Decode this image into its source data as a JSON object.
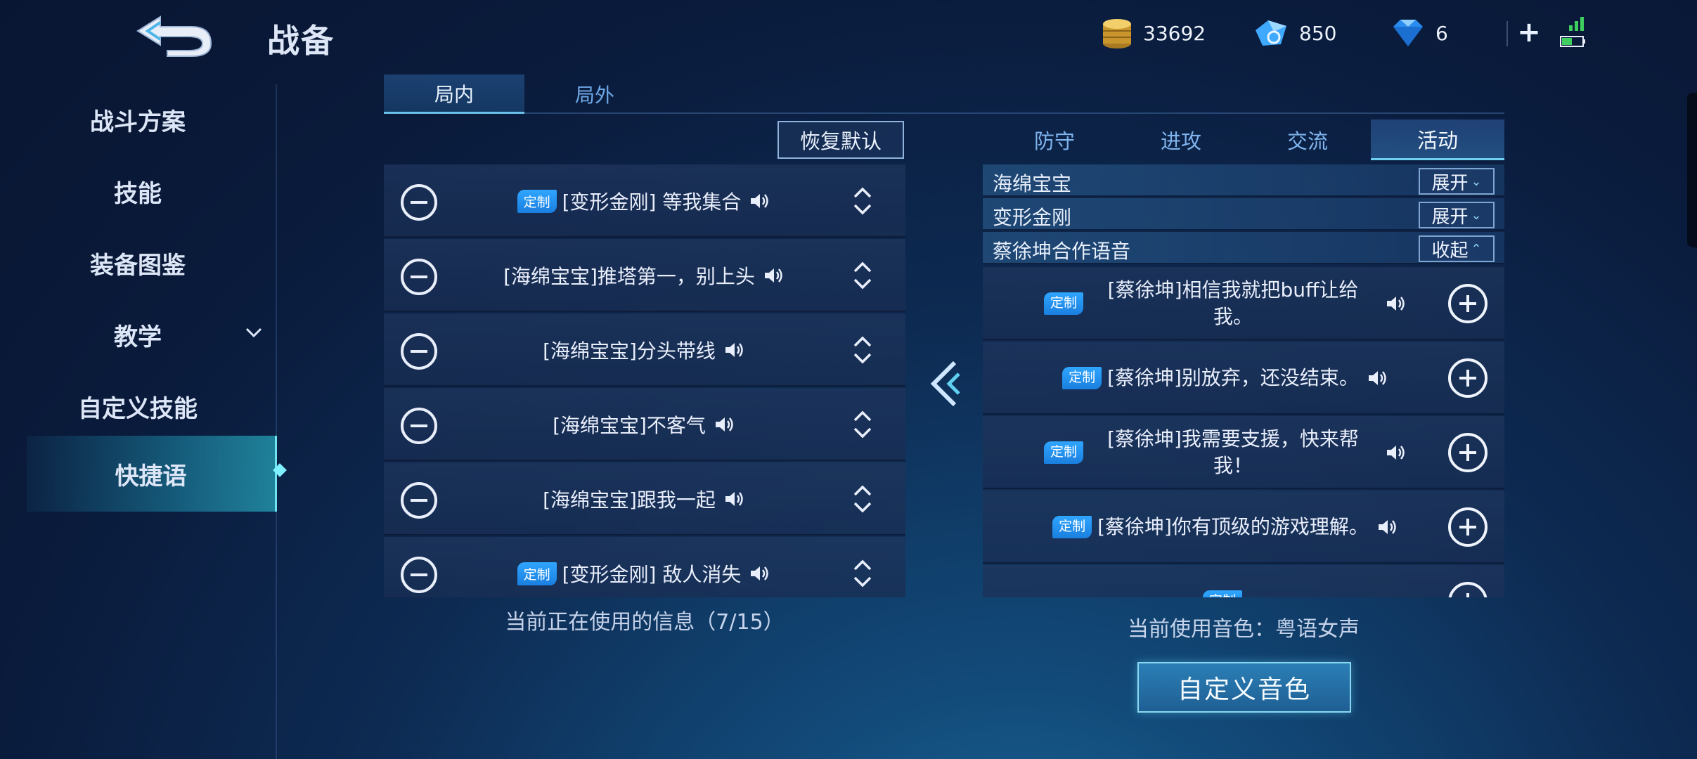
{
  "header": {
    "title": "战备",
    "currencies": [
      {
        "name": "gold-coin",
        "value": "33692"
      },
      {
        "name": "ticket",
        "value": "850"
      },
      {
        "name": "diamond",
        "value": "6"
      }
    ],
    "add_label": "+"
  },
  "left_nav": {
    "items": [
      {
        "label": "战斗方案"
      },
      {
        "label": "技能"
      },
      {
        "label": "装备图鉴"
      },
      {
        "label": "教学"
      },
      {
        "label": "自定义技能"
      },
      {
        "label": "快捷语"
      }
    ],
    "active_index": 5
  },
  "tabs": {
    "in_game": "局内",
    "out_game": "局外"
  },
  "restore_default": "恢复默认",
  "current_list": {
    "rows": [
      {
        "badge": "定制",
        "text": "[变形金刚] 等我集合"
      },
      {
        "badge": "",
        "text": "[海绵宝宝]推塔第一，别上头"
      },
      {
        "badge": "",
        "text": "[海绵宝宝]分头带线"
      },
      {
        "badge": "",
        "text": "[海绵宝宝]不客气"
      },
      {
        "badge": "",
        "text": "[海绵宝宝]跟我一起"
      },
      {
        "badge": "定制",
        "text": "[变形金刚] 敌人消失"
      }
    ],
    "usage_info": "当前正在使用的信息（7/15）"
  },
  "categories": {
    "defend": "防守",
    "attack": "进攻",
    "communicate": "交流",
    "activity": "活动"
  },
  "activity": {
    "groups": [
      {
        "name": "海绵宝宝",
        "button": "展开",
        "dir": "⌄"
      },
      {
        "name": "变形金刚",
        "button": "展开",
        "dir": "⌄"
      },
      {
        "name": "蔡徐坤合作语音",
        "button": "收起",
        "dir": "⌃"
      }
    ],
    "rows": [
      {
        "badge": "定制",
        "text": "[蔡徐坤]相信我就把buff让给我。"
      },
      {
        "badge": "定制",
        "text": "[蔡徐坤]别放弃，还没结束。"
      },
      {
        "badge": "定制",
        "text": "[蔡徐坤]我需要支援，快来帮我！"
      },
      {
        "badge": "定制",
        "text": "[蔡徐坤]你有顶级的游戏理解。"
      },
      {
        "badge": "定制",
        "text": ""
      }
    ],
    "current_voice": "当前使用音色：粤语女声"
  },
  "custom_voice_button": "自定义音色",
  "colors": {
    "accent": "#6fcff0",
    "badge": "#2fa6ff",
    "background": "#0d2a52"
  }
}
